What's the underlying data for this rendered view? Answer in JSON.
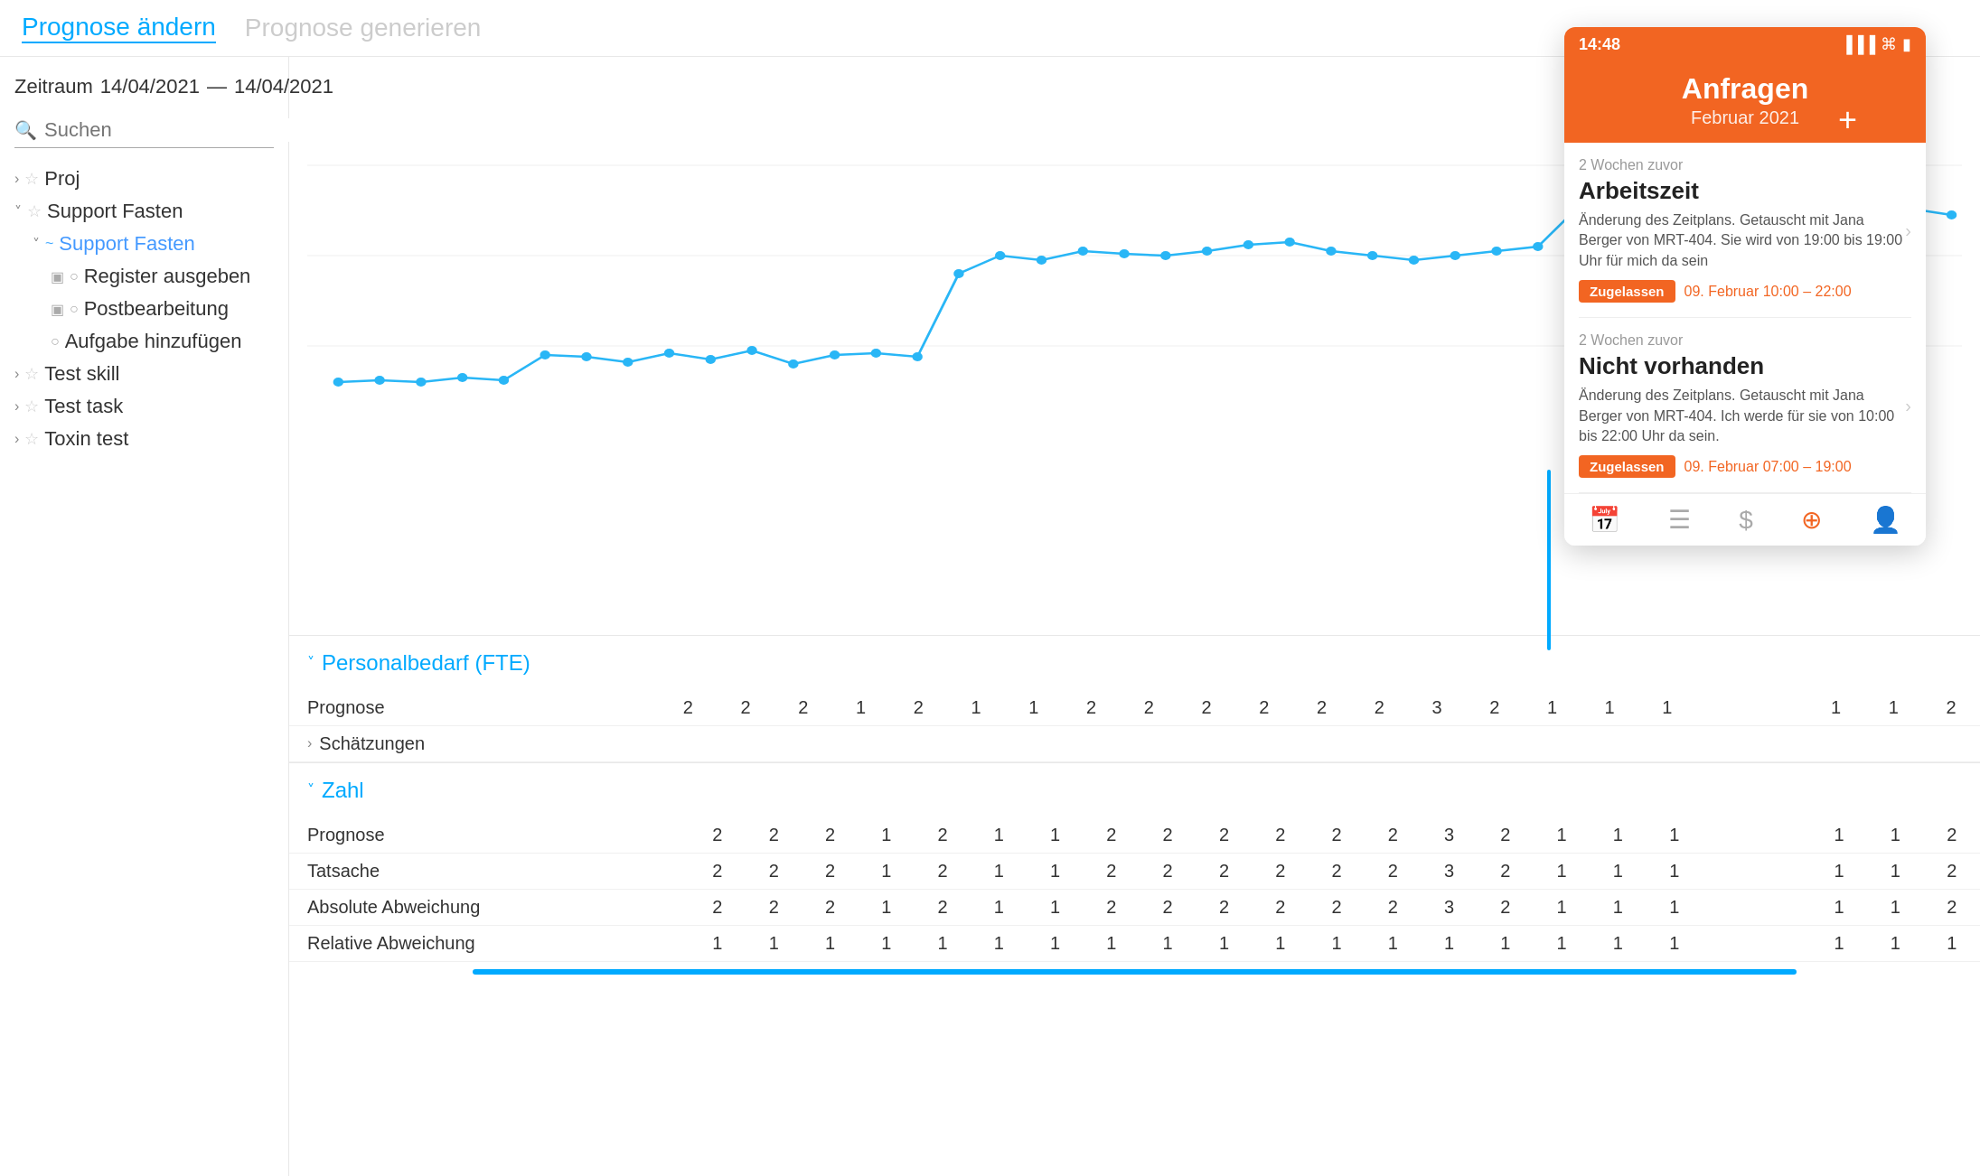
{
  "nav": {
    "link1": "Prognose ändern",
    "link2": "Prognose generieren"
  },
  "filters": {
    "zeitraum_label": "Zeitraum",
    "date_from": "14/04/2021",
    "date_sep": "—",
    "date_to": "14/04/2021",
    "search_placeholder": "Suchen"
  },
  "tree": {
    "items": [
      {
        "id": "proj",
        "label": "Proj",
        "indent": 0,
        "type": "star",
        "expanded": false
      },
      {
        "id": "support-fasten",
        "label": "Support Fasten",
        "indent": 0,
        "type": "star",
        "expanded": true
      },
      {
        "id": "support-fasten-sub",
        "label": "Support Fasten",
        "indent": 1,
        "type": "blue-link",
        "expanded": true
      },
      {
        "id": "register",
        "label": "Register ausgeben",
        "indent": 2,
        "type": "doc"
      },
      {
        "id": "postbearbeitung",
        "label": "Postbearbeitung",
        "indent": 2,
        "type": "doc"
      },
      {
        "id": "aufgabe",
        "label": "Aufgabe hinzufügen",
        "indent": 2,
        "type": "plain"
      },
      {
        "id": "test-skill",
        "label": "Test skill",
        "indent": 0,
        "type": "star",
        "expanded": false
      },
      {
        "id": "test-task",
        "label": "Test task",
        "indent": 0,
        "type": "star",
        "expanded": false
      },
      {
        "id": "toxin-test",
        "label": "Toxin test",
        "indent": 0,
        "type": "star",
        "expanded": false
      }
    ]
  },
  "chart": {
    "points": [
      350,
      350,
      350,
      355,
      350,
      410,
      405,
      395,
      410,
      380,
      400,
      420,
      410,
      415,
      405,
      550,
      600,
      590,
      620,
      610,
      615,
      600,
      620,
      640,
      645,
      620,
      610,
      600,
      610,
      620,
      700,
      680,
      690,
      670,
      660,
      665,
      620,
      700,
      710,
      680
    ]
  },
  "sections": {
    "personalbedarf": {
      "title": "Personalbedarf (FTE)",
      "rows": [
        {
          "label": "Prognose",
          "values": [
            2,
            2,
            2,
            1,
            2,
            1,
            1,
            2,
            2,
            2,
            2,
            2,
            2,
            3,
            2,
            1,
            1,
            1,
            "",
            "",
            "",
            "",
            1,
            1,
            2
          ]
        },
        {
          "label": "Schätzungen",
          "values": []
        }
      ]
    },
    "zahl": {
      "title": "Zahl",
      "rows": [
        {
          "label": "Prognose",
          "values": [
            2,
            2,
            2,
            1,
            2,
            1,
            1,
            2,
            2,
            2,
            2,
            2,
            2,
            3,
            2,
            1,
            1,
            1,
            "",
            "",
            "",
            "",
            1,
            1,
            2
          ]
        },
        {
          "label": "Tatsache",
          "values": [
            2,
            2,
            2,
            1,
            2,
            1,
            1,
            2,
            2,
            2,
            2,
            2,
            2,
            3,
            2,
            1,
            1,
            1,
            "",
            "",
            "",
            "",
            1,
            1,
            2
          ]
        },
        {
          "label": "Absolute Abweichung",
          "values": [
            2,
            2,
            2,
            1,
            2,
            1,
            1,
            2,
            2,
            2,
            2,
            2,
            2,
            3,
            2,
            1,
            1,
            1,
            "",
            "",
            "",
            "",
            1,
            1,
            2
          ]
        },
        {
          "label": "Relative Abweichung",
          "values": [
            1,
            1,
            1,
            1,
            1,
            1,
            1,
            1,
            1,
            1,
            1,
            1,
            1,
            1,
            1,
            1,
            1,
            1,
            "",
            "",
            "",
            "",
            1,
            1,
            1
          ]
        }
      ]
    }
  },
  "mobile": {
    "status_time": "14:48",
    "title": "Anfragen",
    "subtitle": "Februar 2021",
    "plus_label": "+",
    "requests": [
      {
        "time_ago": "2 Wochen zuvor",
        "title": "Arbeitszeit",
        "desc": "Änderung des Zeitplans. Getauscht mit Jana Berger von MRT-404. Sie wird von 19:00 bis 19:00 Uhr für mich da sein",
        "badge": "Zugelassen",
        "time_range": "09. Februar 10:00 – 22:00"
      },
      {
        "time_ago": "2 Wochen zuvor",
        "title": "Nicht vorhanden",
        "desc": "Änderung des Zeitplans. Getauscht mit Jana Berger von MRT-404. Ich werde für sie von 10:00 bis 22:00 Uhr da sein.",
        "badge": "Zugelassen",
        "time_range": "09. Februar 07:00 – 19:00"
      }
    ],
    "bottom_nav": [
      "calendar",
      "list",
      "dollar",
      "plus-circle",
      "person"
    ]
  }
}
